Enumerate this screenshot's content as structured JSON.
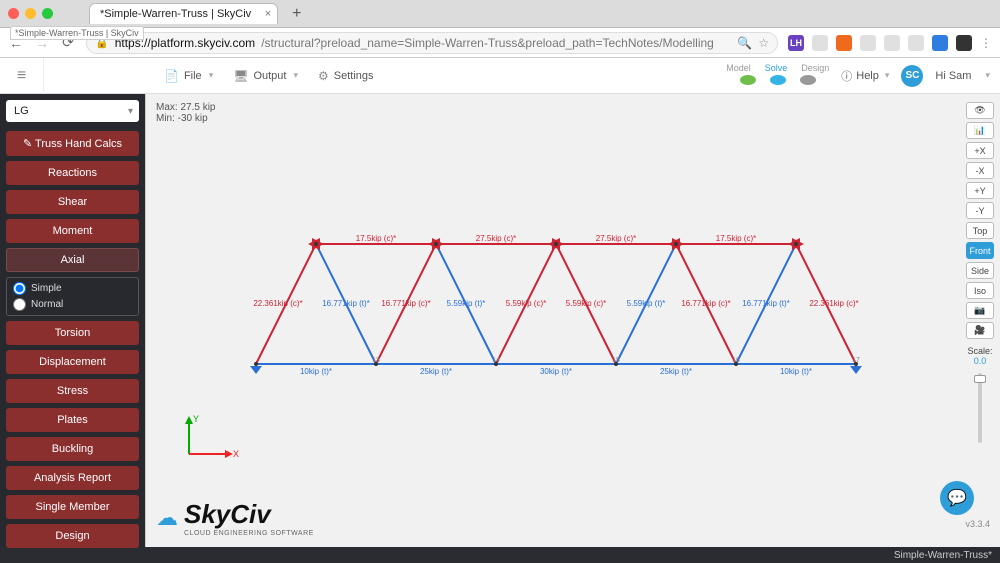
{
  "browser": {
    "tab_title": "*Simple-Warren-Truss | SkyCiv",
    "pinned_hint": "*Simple-Warren-Truss | SkyCiv",
    "url_host": "https://platform.skyciv.com",
    "url_path": "/structural?preload_name=Simple-Warren-Truss&preload_path=TechNotes/Modelling",
    "ext_lh": "LH"
  },
  "app": {
    "menu": {
      "file": "File",
      "output": "Output",
      "settings": "Settings"
    },
    "modes": {
      "model": "Model",
      "solve": "Solve",
      "design": "Design"
    },
    "help": "Help",
    "user_initials": "SC",
    "user_label": "Hi Sam"
  },
  "sidebar": {
    "select_value": "LG",
    "buttons": {
      "hand": "✎ Truss Hand Calcs",
      "reactions": "Reactions",
      "shear": "Shear",
      "moment": "Moment",
      "axial": "Axial",
      "torsion": "Torsion",
      "displacement": "Displacement",
      "stress": "Stress",
      "plates": "Plates",
      "buckling": "Buckling",
      "report": "Analysis Report",
      "single": "Single Member",
      "design": "Design"
    },
    "subopts": {
      "simple": "Simple",
      "normal": "Normal"
    }
  },
  "canvas": {
    "max": "Max: 27.5 kip",
    "min": "Min: -30 kip",
    "axis_x": "X",
    "axis_y": "Y",
    "logo_text": "SkyCiv",
    "logo_sub": "CLOUD ENGINEERING SOFTWARE"
  },
  "truss": {
    "top": [
      "17.5kip (c)*",
      "27.5kip (c)*",
      "27.5kip (c)*",
      "17.5kip (c)*"
    ],
    "bottom": [
      "10kip (t)*",
      "25kip (t)*",
      "30kip (t)*",
      "25kip (t)*",
      "10kip (t)*"
    ],
    "diag": [
      "22.361kip (c)*",
      "16.771kip (t)*",
      "16.771kip (c)*",
      "5.59kip (t)*",
      "5.59kip (c)*",
      "5.59kip (c)*",
      "5.59kip (t)*",
      "16.771kip (c)*",
      "16.771kip (t)*",
      "22.361kip (c)*"
    ],
    "bottom_nodes": [
      "13",
      "14",
      "15",
      "16",
      "17"
    ]
  },
  "rail": {
    "plusx": "+X",
    "minusx": "-X",
    "plusy": "+Y",
    "minusy": "-Y",
    "top": "Top",
    "front": "Front",
    "side": "Side",
    "iso": "Iso",
    "scale_label": "Scale:",
    "scale_value": "0.0"
  },
  "footer": {
    "version": "v3.3.4",
    "status": "Simple-Warren-Truss*"
  }
}
